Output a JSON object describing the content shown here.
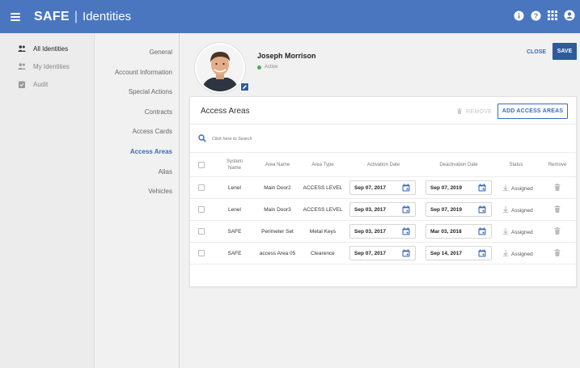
{
  "app": {
    "brand": "SAFE",
    "section": "Identities"
  },
  "colors": {
    "header": "#4a76c0",
    "accent": "#3b6bb8",
    "save": "#2f5a9c",
    "status_active": "#4caf50"
  },
  "top_icons": [
    "info-icon",
    "help-icon",
    "apps-grid-icon",
    "account-icon"
  ],
  "left_nav": [
    {
      "label": "All Identities",
      "icon": "people-icon",
      "active": true
    },
    {
      "label": "My Identities",
      "icon": "people-icon",
      "active": false
    },
    {
      "label": "Audit",
      "icon": "audit-icon",
      "active": false
    }
  ],
  "sub_nav": [
    {
      "label": "General",
      "active": false
    },
    {
      "label": "Account Information",
      "active": false
    },
    {
      "label": "Special Actions",
      "active": false
    },
    {
      "label": "Contracts",
      "active": false
    },
    {
      "label": "Access Cards",
      "active": false
    },
    {
      "label": "Access Areas",
      "active": true
    },
    {
      "label": "Alias",
      "active": false
    },
    {
      "label": "Vehicles",
      "active": false
    }
  ],
  "profile": {
    "name": "Joseph Morrison",
    "status": "Active"
  },
  "actions": {
    "close": "CLOSE",
    "save": "SAVE"
  },
  "access_areas": {
    "title": "Access Areas",
    "remove_label": "REMOVE",
    "add_label": "ADD ACCESS AREAS",
    "search_placeholder": "Click here to Search",
    "columns": {
      "system_name": "System Name",
      "area_name": "Area Name",
      "area_type": "Area Type",
      "activation": "Activation Date",
      "deactivation": "Deactivation Date",
      "status": "Status",
      "remove": "Remove"
    },
    "rows": [
      {
        "system": "Lenel",
        "area": "Main Door2",
        "type": "ACCESS LEVEL",
        "activation": "Sep 07, 2017",
        "deactivation": "Sep 07, 2019",
        "status": "Assigned"
      },
      {
        "system": "Lenel",
        "area": "Main Door3",
        "type": "ACCESS LEVEL",
        "activation": "Sep 03, 2017",
        "deactivation": "Sep 07, 2019",
        "status": "Assigned"
      },
      {
        "system": "SAFE",
        "area": "Perimeter Set",
        "type": "Metal Keys",
        "activation": "Sep 03, 2017",
        "deactivation": "Mar 03, 2018",
        "status": "Assigned"
      },
      {
        "system": "SAFE",
        "area": "access Area 05",
        "type": "Clearence",
        "activation": "Sep 07, 2017",
        "deactivation": "Sep 14, 2017",
        "status": "Assigned"
      }
    ]
  }
}
